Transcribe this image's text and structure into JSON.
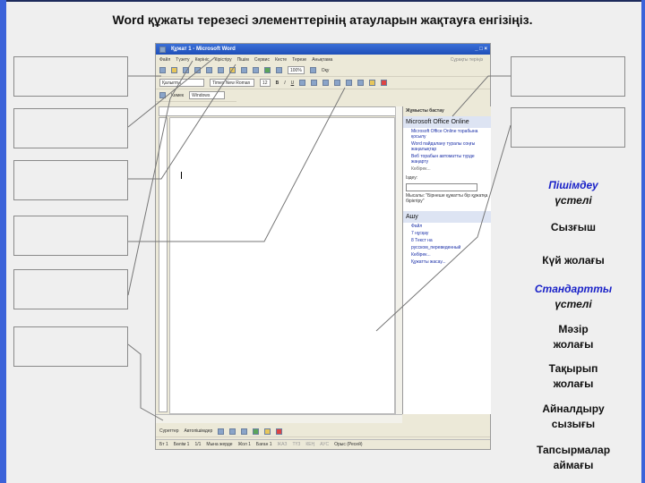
{
  "title": "Word құжаты терезесі элементтерінің атауларын жақтауға енгізіңіз.",
  "word": {
    "window_title": "Құжат 1 - Microsoft Word",
    "menu": [
      "Файл",
      "Түзету",
      "Көрініс",
      "Кірістіру",
      "Пішім",
      "Сервис",
      "Кесте",
      "Терезе",
      "Анықтама"
    ],
    "help_placeholder": "Сұрақты теріңіз",
    "zoom": "100%",
    "style": "Қалыпты",
    "font": "Times New Roman",
    "size": "12",
    "read_label": "Оқу",
    "third_toolbar": [
      "Көмек",
      "Windows"
    ],
    "task_pane": {
      "title": "Жұмысты бастау",
      "online": "Microsoft Office Online",
      "links": [
        "Microsoft Office Online торабына қосылу",
        "Word пайдалану туралы соңғы жаңалықтар",
        "Веб торабын автоматты түрде жаңарту"
      ],
      "more": "Көбірек...",
      "search_label": "Іздеу:",
      "example": "Мысалы: \"Бірнеше құжатты бір құжатқа біріктіру\"",
      "open_title": "Ашу",
      "open_items": [
        "Файл",
        "7 нұсқау",
        "8 Текст на",
        "русском_переведенный"
      ],
      "more_files": "Көбірек...",
      "new_doc": "Құжатты жасау..."
    },
    "drawing": [
      "Суреттер",
      "Автопішімдер"
    ],
    "status": [
      "Бт 1",
      "Бөлім 1",
      "1/1",
      "Мына жерде",
      "Жол 1",
      "Баған 1",
      "ЖАЗ",
      "ТҮЗ",
      "КЕҢ",
      "АУС",
      "Орыс (Ресей)"
    ]
  },
  "labels": [
    {
      "lines": [
        "Пішімдеу",
        "үстелі"
      ],
      "blue": true
    },
    {
      "lines": [
        "Сызғыш"
      ]
    },
    {
      "lines": [
        "Күй жолағы"
      ]
    },
    {
      "lines": [
        "Стандартты",
        "үстелі"
      ],
      "blue": true
    },
    {
      "lines": [
        "Мәзір",
        "жолағы"
      ]
    },
    {
      "lines": [
        "Тақырып",
        "жолағы"
      ]
    },
    {
      "lines": [
        "Айналдыру",
        "сызығы"
      ]
    },
    {
      "lines": [
        "Тапсырмалар",
        "аймағы"
      ]
    }
  ]
}
